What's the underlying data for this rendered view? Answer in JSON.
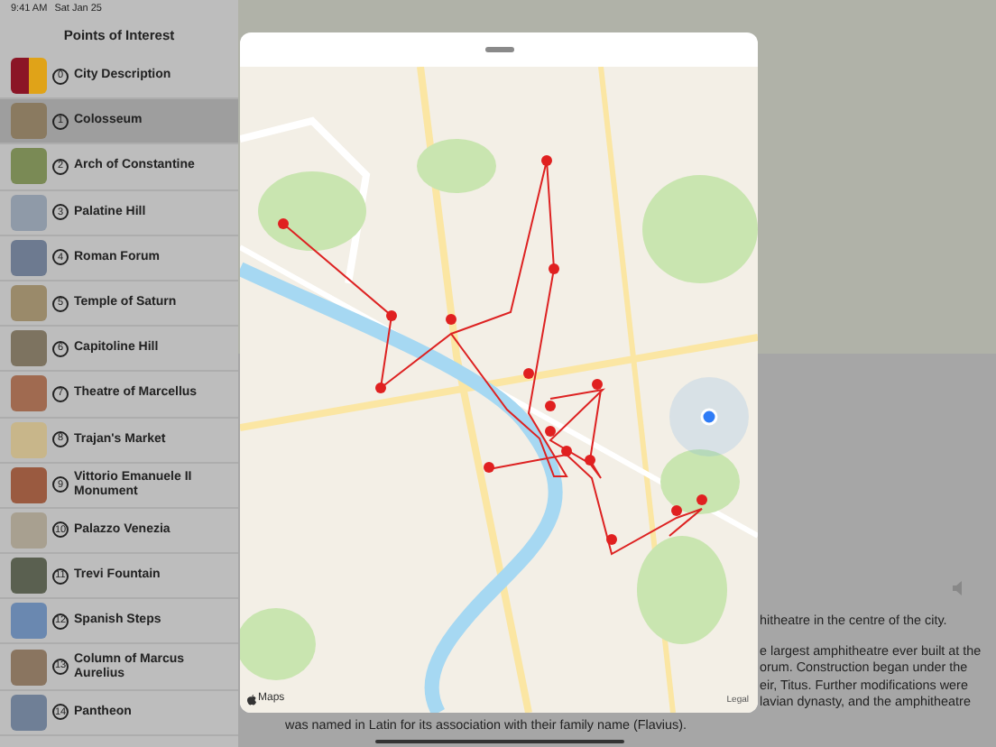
{
  "status_bar": {
    "time": "9:41 AM",
    "date": "Sat Jan 25"
  },
  "sidebar": {
    "title": "Points of Interest",
    "items": [
      {
        "number": "0",
        "label": "City Description",
        "selected": false,
        "kind": "flag"
      },
      {
        "number": "1",
        "label": "Colosseum",
        "selected": true,
        "kind": "photo"
      },
      {
        "number": "2",
        "label": "Arch of Constantine",
        "selected": false,
        "kind": "photo"
      },
      {
        "number": "3",
        "label": "Palatine Hill",
        "selected": false,
        "kind": "photo"
      },
      {
        "number": "4",
        "label": "Roman Forum",
        "selected": false,
        "kind": "photo"
      },
      {
        "number": "5",
        "label": "Temple of Saturn",
        "selected": false,
        "kind": "photo"
      },
      {
        "number": "6",
        "label": "Capitoline Hill",
        "selected": false,
        "kind": "photo"
      },
      {
        "number": "7",
        "label": "Theatre of Marcellus",
        "selected": false,
        "kind": "photo"
      },
      {
        "number": "8",
        "label": "Trajan's Market",
        "selected": false,
        "kind": "photo"
      },
      {
        "number": "9",
        "label": "Vittorio Emanuele II Monument",
        "selected": false,
        "kind": "photo"
      },
      {
        "number": "10",
        "label": "Palazzo Venezia",
        "selected": false,
        "kind": "photo"
      },
      {
        "number": "11",
        "label": "Trevi Fountain",
        "selected": false,
        "kind": "photo"
      },
      {
        "number": "12",
        "label": "Spanish Steps",
        "selected": false,
        "kind": "photo"
      },
      {
        "number": "13",
        "label": "Column of Marcus Aurelius",
        "selected": false,
        "kind": "photo"
      },
      {
        "number": "14",
        "label": "Pantheon",
        "selected": false,
        "kind": "photo"
      }
    ]
  },
  "map_sheet": {
    "attribution": "Maps",
    "legal": "Legal"
  },
  "detail": {
    "lines": [
      "hitheatre in the centre of the city.",
      "e largest amphitheatre ever built at the",
      "orum. Construction began under the",
      "eir, Titus. Further modifications were",
      "lavian dynasty, and the amphitheatre"
    ],
    "last_line": "was named in Latin for its association with their family name (Flavius)."
  }
}
